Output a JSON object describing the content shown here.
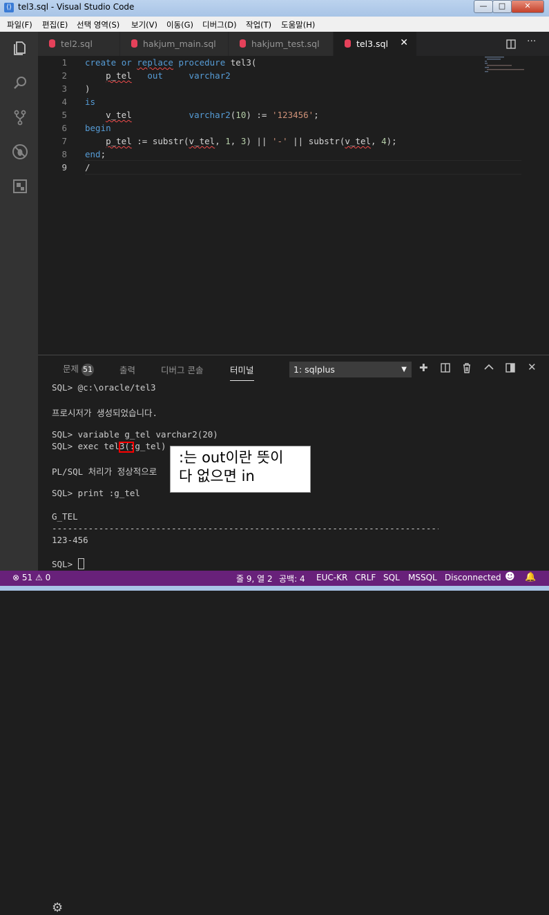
{
  "window": {
    "title": "tel3.sql - Visual Studio Code",
    "minimize": "—",
    "maximize": "□",
    "close": "✕"
  },
  "menu": [
    "파일(F)",
    "편집(E)",
    "선택 영역(S)",
    "보기(V)",
    "이동(G)",
    "디버그(D)",
    "작업(T)",
    "도움말(H)"
  ],
  "tabs": [
    {
      "label": "tel2.sql"
    },
    {
      "label": "hakjum_main.sql"
    },
    {
      "label": "hakjum_test.sql"
    },
    {
      "label": "tel3.sql",
      "close": "✕"
    }
  ],
  "editor": {
    "line_numbers": [
      "1",
      "2",
      "3",
      "4",
      "5",
      "6",
      "7",
      "8",
      "9"
    ],
    "lines": [
      "create or replace procedure tel3(",
      "    p_tel   out     varchar2",
      ")",
      "is",
      "    v_tel           varchar2(10) := '123456';",
      "begin",
      "    p_tel := substr(v_tel, 1, 3) || '-' || substr(v_tel, 4);",
      "end;",
      "/"
    ]
  },
  "panel": {
    "tabs": {
      "problems": "문제",
      "problems_count": "51",
      "output": "출력",
      "debug_console": "디버그 콘솔",
      "terminal": "터미널"
    },
    "terminal_select": "1: sqlplus",
    "terminal_lines": [
      "SQL> @c:\\oracle/tel3",
      "",
      "프로시저가 생성되었습니다.",
      "",
      "SQL> variable g_tel varchar2(20)",
      "SQL> exec tel3(:g_tel)",
      "",
      "PL/SQL 처리가 정상적으로",
      "",
      "SQL> print :g_tel",
      "",
      "G_TEL",
      "--------------------------------------------------------------------------------",
      "123-456",
      "",
      "SQL> "
    ]
  },
  "annotation": {
    "line1": ":는 out이란 뜻이",
    "line2": "다 없으면 in"
  },
  "status": {
    "errors": "51",
    "warnings": "0",
    "position": "줄 9, 열 2",
    "spaces": "공백: 4",
    "encoding": "EUC-KR",
    "eol": "CRLF",
    "language": "SQL",
    "dialect": "MSSQL",
    "connection": "Disconnected"
  },
  "colors": {
    "status_bar": "#68217a",
    "keyword": "#569cd6",
    "string": "#ce9178",
    "number": "#b5cea8",
    "highlight_box": "#ff0000"
  }
}
